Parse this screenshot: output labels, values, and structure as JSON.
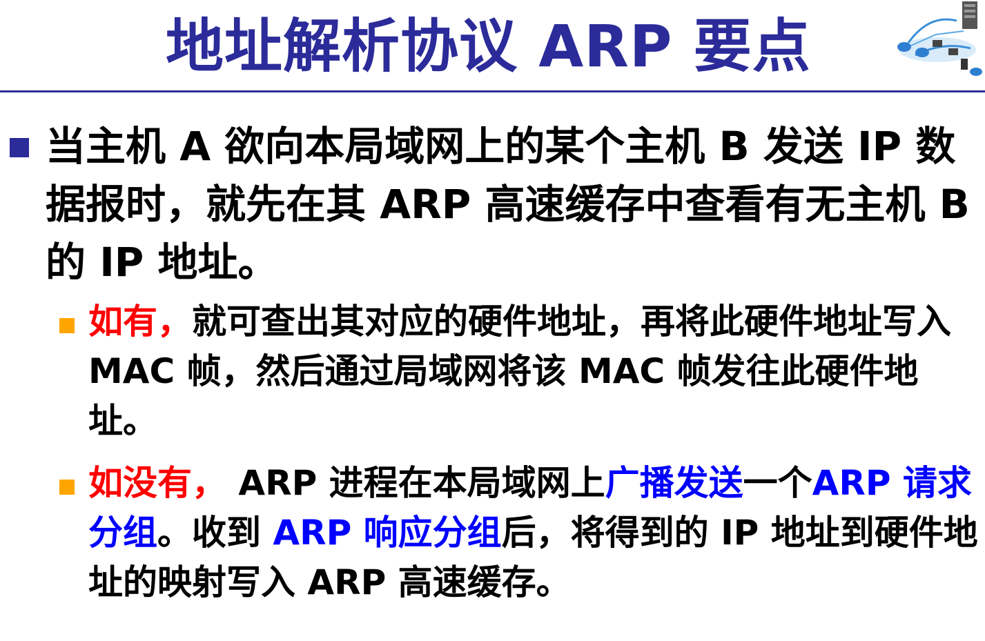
{
  "title": "地址解析协议 ARP 要点",
  "logo_icon": "network-diagram-icon",
  "colors": {
    "title": "#2b2b9a",
    "bullet_l1": "#2b2b9a",
    "bullet_l2": "#ffa500",
    "highlight_red": "#ff0000",
    "highlight_blue": "#0000ff"
  },
  "point1": {
    "text": "当主机 A 欲向本局域网上的某个主机 B 发送 IP 数据报时，就先在其 ARP 高速缓存中查看有无主机 B 的 IP 地址。"
  },
  "sub1": {
    "lead": "如有，",
    "text": "就可查出其对应的硬件地址，再将此硬件地址写入 MAC 帧，然后通过局域网将该 MAC 帧发往此硬件地址。"
  },
  "sub2": {
    "lead": "如没有，",
    "t1": " ARP 进程在本局域网上",
    "b1": "广播发送",
    "t2": "一个",
    "b2": "ARP 请求分组",
    "t3": "。收到 ",
    "b3": "ARP 响应分组",
    "t4": "后，将得到的 IP 地址到硬件地址的映射写入 ARP 高速缓存。"
  }
}
